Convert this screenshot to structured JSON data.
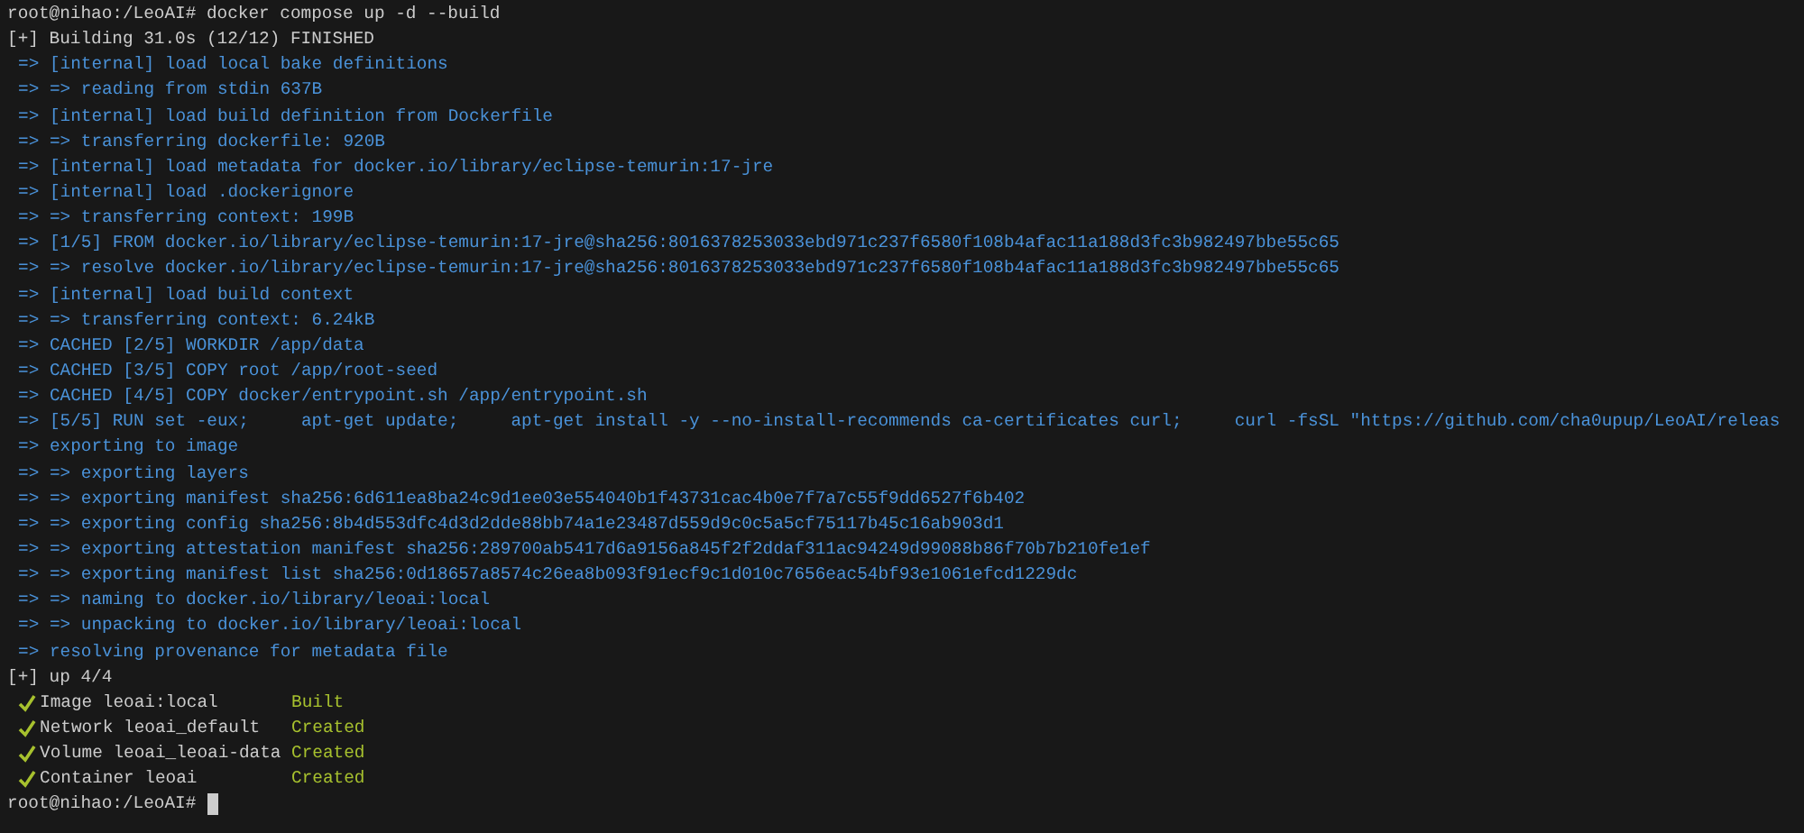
{
  "lines": [
    {
      "kind": "prompt",
      "text": "root@nihao:/LeoAI# docker compose up -d --build",
      "cursor": false
    },
    {
      "kind": "plain",
      "text": "[+] Building 31.0s (12/12) FINISHED"
    },
    {
      "kind": "step",
      "text": "=> [internal] load local bake definitions"
    },
    {
      "kind": "step",
      "text": "=> => reading from stdin 637B"
    },
    {
      "kind": "step",
      "text": "=> [internal] load build definition from Dockerfile"
    },
    {
      "kind": "step",
      "text": "=> => transferring dockerfile: 920B"
    },
    {
      "kind": "step",
      "text": "=> [internal] load metadata for docker.io/library/eclipse-temurin:17-jre"
    },
    {
      "kind": "step",
      "text": "=> [internal] load .dockerignore"
    },
    {
      "kind": "step",
      "text": "=> => transferring context: 199B"
    },
    {
      "kind": "step",
      "text": "=> [1/5] FROM docker.io/library/eclipse-temurin:17-jre@sha256:8016378253033ebd971c237f6580f108b4afac11a188d3fc3b982497bbe55c65"
    },
    {
      "kind": "step",
      "text": "=> => resolve docker.io/library/eclipse-temurin:17-jre@sha256:8016378253033ebd971c237f6580f108b4afac11a188d3fc3b982497bbe55c65"
    },
    {
      "kind": "step",
      "text": "=> [internal] load build context"
    },
    {
      "kind": "step",
      "text": "=> => transferring context: 6.24kB"
    },
    {
      "kind": "step",
      "text": "=> CACHED [2/5] WORKDIR /app/data"
    },
    {
      "kind": "step",
      "text": "=> CACHED [3/5] COPY root /app/root-seed"
    },
    {
      "kind": "step",
      "text": "=> CACHED [4/5] COPY docker/entrypoint.sh /app/entrypoint.sh"
    },
    {
      "kind": "step",
      "text": "=> [5/5] RUN set -eux;     apt-get update;     apt-get install -y --no-install-recommends ca-certificates curl;     curl -fsSL \"https://github.com/cha0upup/LeoAI/releas"
    },
    {
      "kind": "step",
      "text": "=> exporting to image"
    },
    {
      "kind": "step",
      "text": "=> => exporting layers"
    },
    {
      "kind": "step",
      "text": "=> => exporting manifest sha256:6d611ea8ba24c9d1ee03e554040b1f43731cac4b0e7f7a7c55f9dd6527f6b402"
    },
    {
      "kind": "step",
      "text": "=> => exporting config sha256:8b4d553dfc4d3d2dde88bb74a1e23487d559d9c0c5a5cf75117b45c16ab903d1"
    },
    {
      "kind": "step",
      "text": "=> => exporting attestation manifest sha256:289700ab5417d6a9156a845f2f2ddaf311ac94249d99088b86f70b7b210fe1ef"
    },
    {
      "kind": "step",
      "text": "=> => exporting manifest list sha256:0d18657a8574c26ea8b093f91ecf9c1d010c7656eac54bf93e1061efcd1229dc"
    },
    {
      "kind": "step",
      "text": "=> => naming to docker.io/library/leoai:local"
    },
    {
      "kind": "step",
      "text": "=> => unpacking to docker.io/library/leoai:local"
    },
    {
      "kind": "step",
      "text": "=> resolving provenance for metadata file"
    },
    {
      "kind": "plain",
      "text": "[+] up 4/4"
    },
    {
      "kind": "result",
      "name": "Image leoai:local",
      "status": "Built"
    },
    {
      "kind": "result",
      "name": "Network leoai_default",
      "status": "Created"
    },
    {
      "kind": "result",
      "name": "Volume leoai_leoai-data",
      "status": "Created"
    },
    {
      "kind": "result",
      "name": "Container leoai",
      "status": "Created"
    },
    {
      "kind": "prompt",
      "text": "root@nihao:/LeoAI#",
      "cursor": true
    }
  ]
}
